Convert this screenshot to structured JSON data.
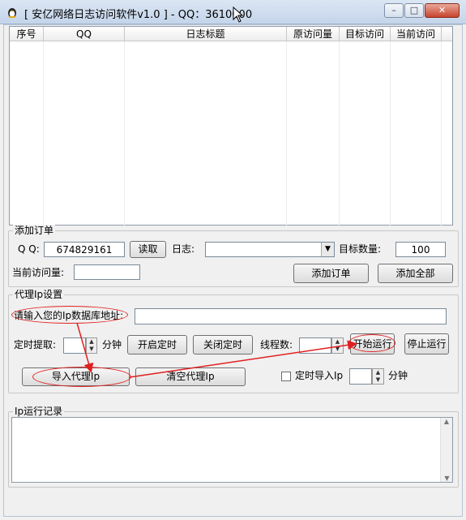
{
  "window": {
    "title": "[ 安亿网络日志访问软件v1.0 ] - QQ：3610000"
  },
  "titlebar_buttons": {
    "minimize": "–",
    "maximize": "□",
    "close": "✕"
  },
  "grid": {
    "columns": [
      "序号",
      "QQ",
      "日志标题",
      "原访问量",
      "目标访问",
      "当前访问"
    ]
  },
  "order_section": {
    "legend": "添加订单",
    "qq_label": "Q Q:",
    "qq_value": "674829161",
    "read_button": "读取",
    "log_label": "日志:",
    "log_value": "",
    "target_label": "目标数量:",
    "target_value": "100",
    "current_label": "当前访问量:",
    "current_value": "",
    "add_order_button": "添加订单",
    "add_all_button": "添加全部"
  },
  "proxy_section": {
    "legend": "代理Ip设置",
    "db_label": "请输入您的Ip数据库地址:",
    "db_value": "",
    "timer_label": "定时提取:",
    "minute_label": "分钟",
    "start_timer_button": "开启定时",
    "stop_timer_button": "关闭定时",
    "threads_label": "线程数:",
    "start_run_button": "开始运行",
    "stop_run_button": "停止运行",
    "import_proxy_button": "导入代理Ip",
    "clear_proxy_button": "清空代理Ip",
    "timed_import_label": "定时导入Ip",
    "minute_label2": "分钟"
  },
  "log_section": {
    "legend": "Ip运行记录"
  },
  "colors": {
    "annotation_red": "#e02020"
  }
}
